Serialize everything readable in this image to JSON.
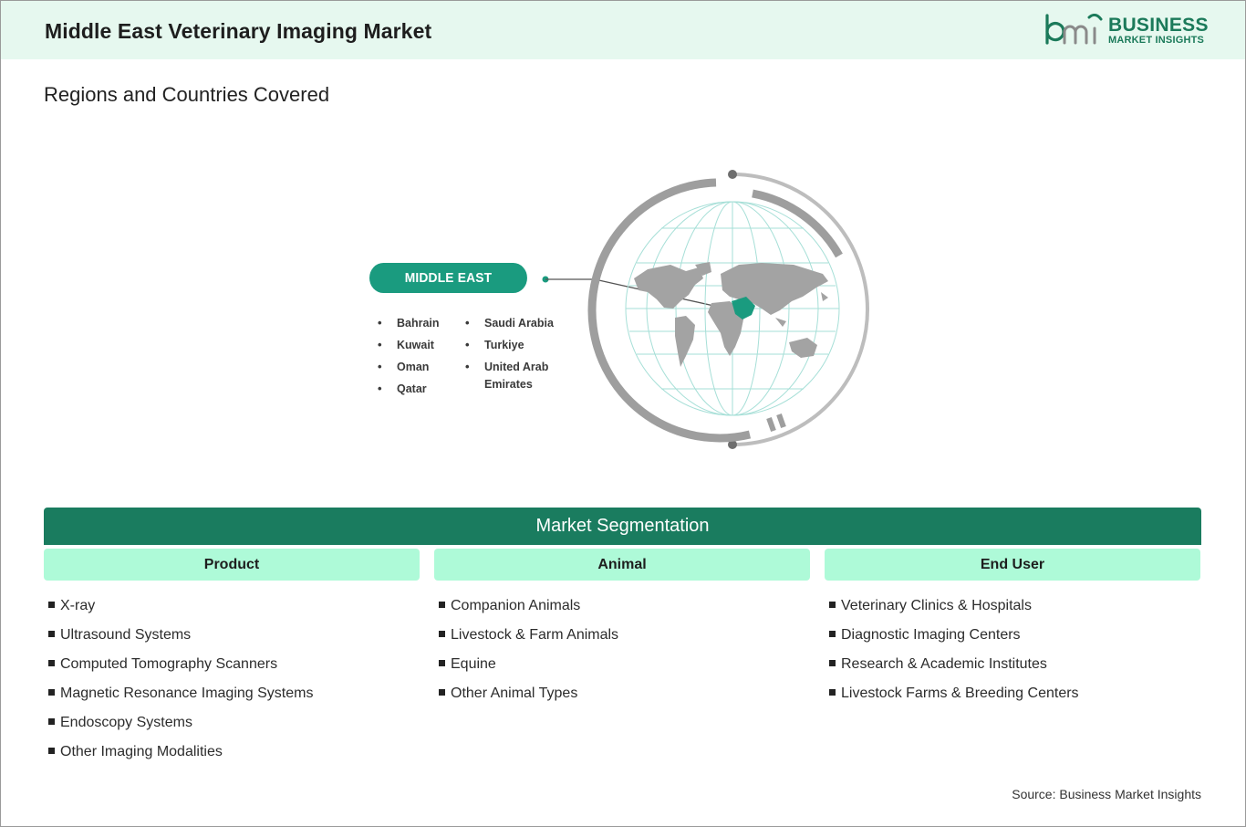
{
  "header": {
    "title": "Middle East Veterinary Imaging Market",
    "logo": {
      "line1": "BUSINESS",
      "line2": "MARKET INSIGHTS",
      "brand_color": "#1b7a5a"
    },
    "background": "#e6f8ef"
  },
  "regions": {
    "title": "Regions and Countries Covered",
    "region_name": "MIDDLE EAST",
    "region_color": "#1a9b7f",
    "countries_left": [
      "Bahrain",
      "Kuwait",
      "Oman",
      "Qatar"
    ],
    "countries_right": [
      "Saudi Arabia",
      "Turkiye",
      "United Arab",
      "Emirates"
    ],
    "globe_icon": "world-globe-icon"
  },
  "segmentation": {
    "title": "Market Segmentation",
    "bar_color": "#1a7c5f",
    "header_color": "#aefad8",
    "columns": [
      {
        "header": "Product",
        "items": [
          "X-ray",
          "Ultrasound Systems",
          "Computed Tomography Scanners",
          "Magnetic Resonance Imaging Systems",
          "Endoscopy Systems",
          "Other Imaging Modalities"
        ]
      },
      {
        "header": "Animal",
        "items": [
          "Companion Animals",
          "Livestock & Farm Animals",
          "Equine",
          "Other Animal Types"
        ]
      },
      {
        "header": "End User",
        "items": [
          "Veterinary Clinics & Hospitals",
          "Diagnostic Imaging Centers",
          "Research & Academic Institutes",
          "Livestock Farms & Breeding Centers"
        ]
      }
    ]
  },
  "source": "Source: Business Market Insights"
}
